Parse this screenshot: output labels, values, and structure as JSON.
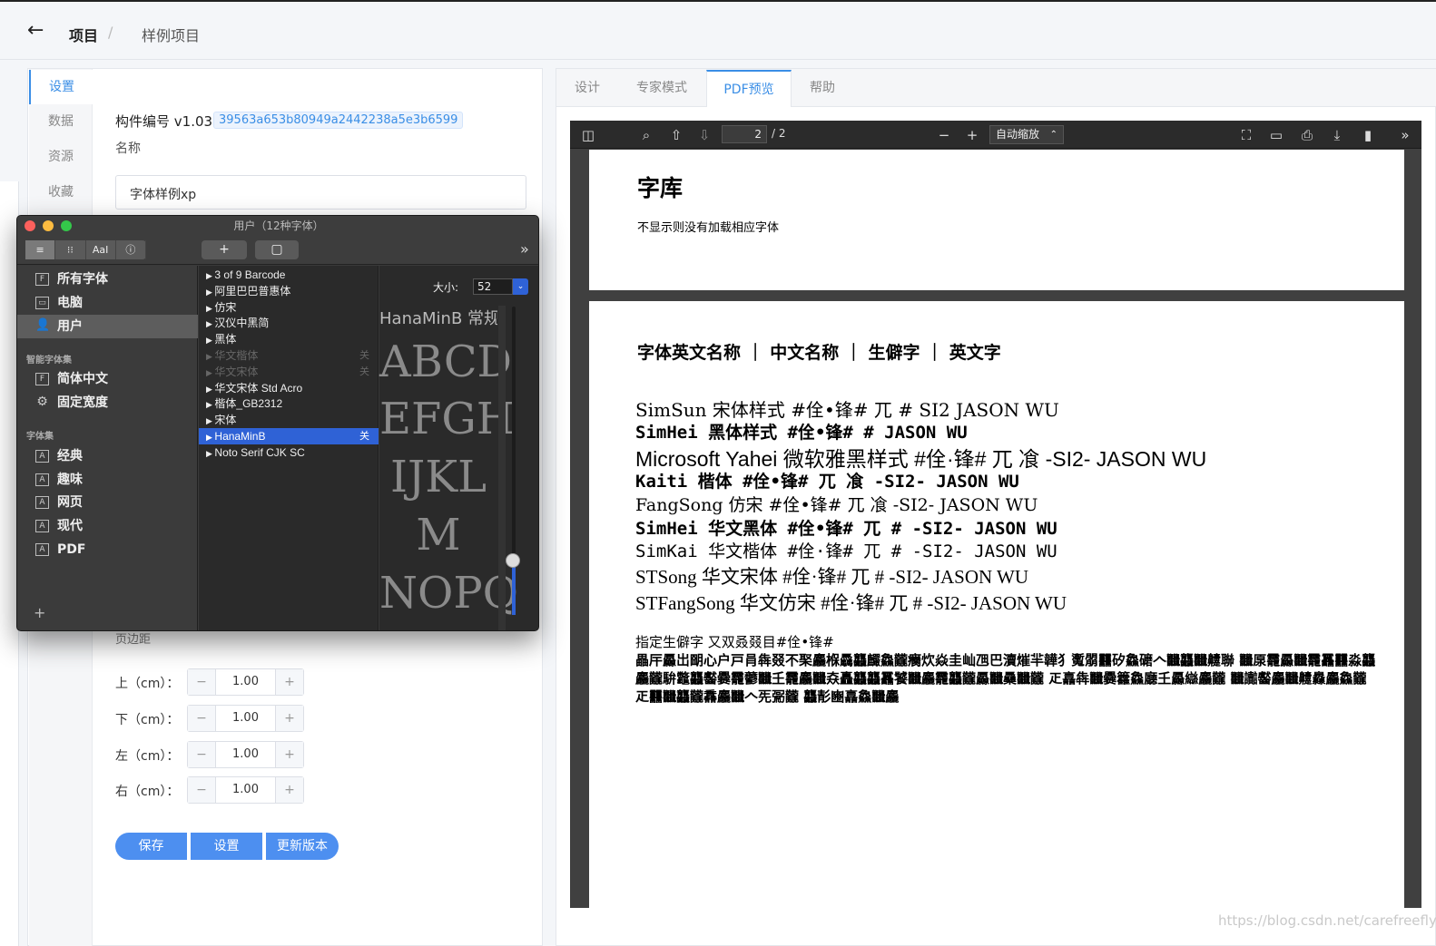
{
  "header": {
    "back_icon": "arrow-left-icon",
    "breadcrumb_root": "项目",
    "breadcrumb_sep": "/",
    "breadcrumb_current": "样例项目"
  },
  "sidenav": {
    "items": [
      "设置",
      "数据",
      "资源",
      "收藏"
    ],
    "active": "设置"
  },
  "settings": {
    "component_id_label": "构件编号 v1.03",
    "component_hash": "39563a653b80949a2442238a5e3b6599",
    "name_label": "名称",
    "name_value": "字体样例xp",
    "margin_label": "页边距",
    "margins": [
      {
        "label": "上（cm）：",
        "value": "1.00"
      },
      {
        "label": "下（cm）：",
        "value": "1.00"
      },
      {
        "label": "左（cm）：",
        "value": "1.00"
      },
      {
        "label": "右（cm）：",
        "value": "1.00"
      }
    ],
    "stepper_minus": "−",
    "stepper_plus": "+",
    "buttons": {
      "save": "保存",
      "settings": "设置",
      "update": "更新版本"
    }
  },
  "tabs": {
    "items": [
      "设计",
      "专家模式",
      "PDF预览",
      "帮助"
    ],
    "active": "PDF预览"
  },
  "pdf_viewer": {
    "page_current": "2",
    "page_total": "/ 2",
    "zoom": "自动缩放",
    "zoom_arrow": "⌃",
    "toolbar_icons": [
      "sidebar-toggle-icon",
      "search-icon",
      "page-up-icon",
      "page-down-icon",
      "zoom-out-icon",
      "zoom-in-icon",
      "fullscreen-icon",
      "open-file-icon",
      "print-icon",
      "download-icon",
      "bookmark-icon",
      "more-tools-icon"
    ],
    "page1": {
      "title": "字库",
      "note": "不显示则没有加载相应字体"
    },
    "page2": {
      "header": "字体英文名称 ｜ 中文名称 ｜ 生僻字 ｜ 英文字",
      "font_lines": [
        "SimSun 宋体样式 #佺•锋# 兀 # SI2 JASON WU",
        "SimHei 黑体样式 #佺•锋# # JASON WU",
        "Microsoft Yahei 微软雅黑样式 #佺·锋# 兀 飡 -SI2- JASON WU",
        "Kaiti 楷体 #佺•锋# 兀 飡 -SI2- JASON WU",
        "FangSong 仿宋 #佺•锋# 兀 飡 -SI2- JASON WU",
        "SimHei 华文黑体 #佺•锋# 兀 # -SI2- JASON WU",
        "SimKai 华文楷体 #佺·锋# 兀 # -SI2- JASON WU",
        "STSong 华文宋体 #佺·锋# 兀 # -SI2- JASON WU",
        "STFangSong 华文仿宋 #佺·锋# 兀 # -SI2- JASON WU"
      ],
      "rare_label": "指定生僻字 又双叒叕目#佺•锋#",
      "rare_chars": "畾厈厵岀朙心户戸肙犇叕不棸麤椺驫龘麣鱻龖癵炊焱圭屾乪巴瀆熣羋韡犭魙朤䨻矽鱻礳𠆢𪚥龘𪚥䶑聯 𪚥厡𥆙龗厵𪚥龗靐䨻𩇔淼龘麤龖䮁龞龘齾爨龗䖇𪚥𡈼龗麤𪚥𡘙𩇔矗龘𩙻龘靐饕𪚥麤龗龘龖厵𪚥䯂𩇔𪚥龖𪓙 𤴓譶犇𪚥爨籱鱻廳𡈼厵䜌𦣦麤龖 𩇔𪚥讟齾麤𪚥䶑灥麤鱻龖𤴓𥃩䨻𪚥龘龖馫麤𪚥𠆢𠀡䰜𩇔龖 龘𩇕豳譶鱻𪚥麤"
    }
  },
  "font_book": {
    "title": "用户（12种字体）",
    "seg_buttons": [
      "≡",
      "⁝⁝",
      "AaI",
      "ⓘ"
    ],
    "add_button": "+",
    "preview_button": "▢",
    "more": "»",
    "collections": [
      "所有字体",
      "电脑",
      "用户"
    ],
    "selected_collection": "用户",
    "smart_header": "智能字体集",
    "smart": [
      "简体中文",
      "固定宽度"
    ],
    "sets_header": "字体集",
    "sets": [
      "经典",
      "趣味",
      "网页",
      "现代",
      "PDF"
    ],
    "add_collection": "+",
    "fonts": [
      {
        "name": "3 of 9 Barcode",
        "state": "normal",
        "badge": ""
      },
      {
        "name": "阿里巴巴普惠体",
        "state": "normal",
        "badge": ""
      },
      {
        "name": "仿宋",
        "state": "normal",
        "badge": ""
      },
      {
        "name": "汉仪中黑简",
        "state": "normal",
        "badge": ""
      },
      {
        "name": "黑体",
        "state": "normal",
        "badge": ""
      },
      {
        "name": "华文楷体",
        "state": "dim",
        "badge": "关"
      },
      {
        "name": "华文宋体",
        "state": "dim",
        "badge": "关"
      },
      {
        "name": "华文宋体 Std Acro",
        "state": "normal",
        "badge": ""
      },
      {
        "name": "楷体_GB2312",
        "state": "normal",
        "badge": ""
      },
      {
        "name": "宋体",
        "state": "normal",
        "badge": ""
      },
      {
        "name": "HanaMinB",
        "state": "sel",
        "badge": "关"
      },
      {
        "name": "Noto Serif CJK SC",
        "state": "normal",
        "badge": ""
      }
    ],
    "size_label": "大小:",
    "size_value": "52",
    "preview_name": "HanaMinB 常规体",
    "preview_lines": [
      "ABCD",
      "EFGH",
      "IJKL",
      "M",
      "NOPQ"
    ]
  },
  "watermark": "https://blog.csdn.net/carefreefly"
}
